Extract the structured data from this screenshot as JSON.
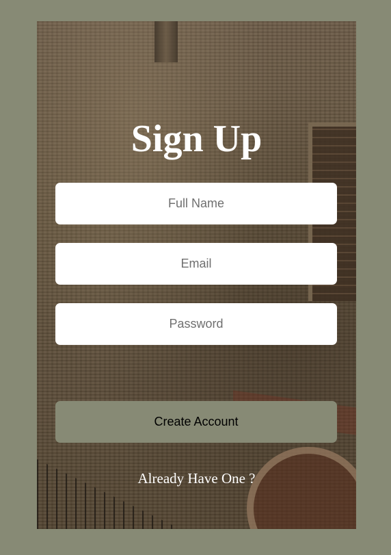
{
  "form": {
    "title": "Sign Up",
    "fields": {
      "full_name_placeholder": "Full Name",
      "email_placeholder": "Email",
      "password_placeholder": "Password"
    },
    "submit_label": "Create Account",
    "login_link_label": "Already Have One ?"
  },
  "colors": {
    "page_background": "#878a75",
    "button_background": "#878a75",
    "title_text": "#ffffff",
    "field_background": "#ffffff"
  }
}
